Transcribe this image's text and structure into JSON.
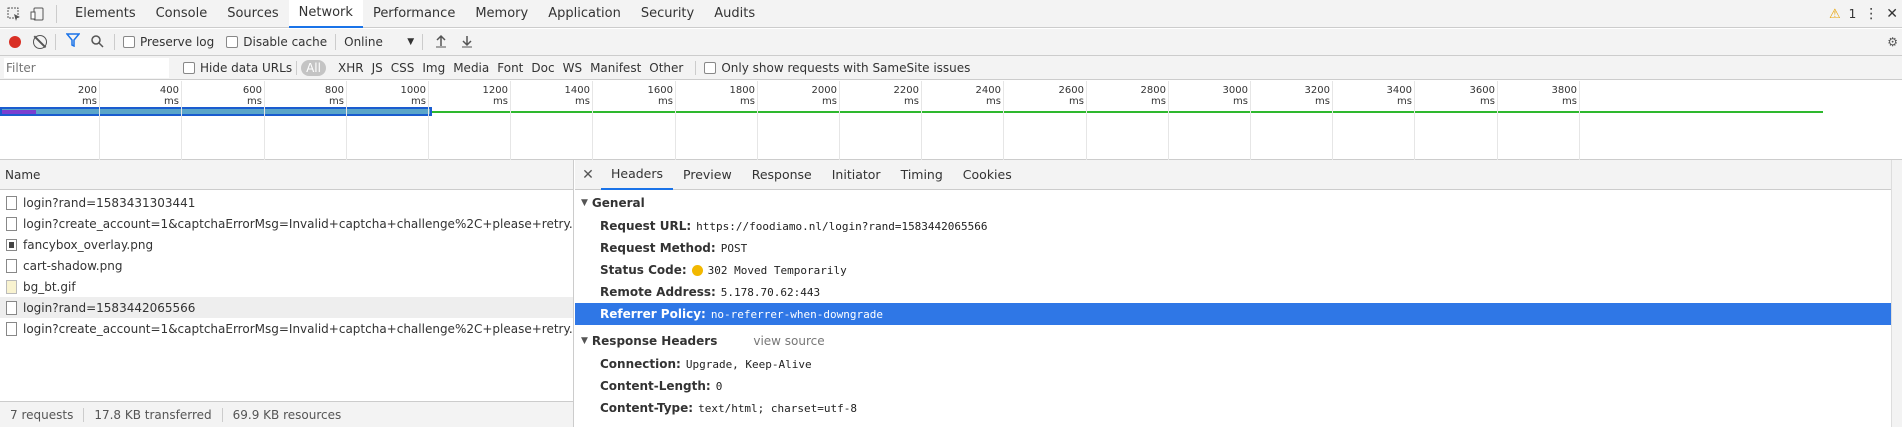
{
  "tabs": [
    "Elements",
    "Console",
    "Sources",
    "Network",
    "Performance",
    "Memory",
    "Application",
    "Security",
    "Audits"
  ],
  "active_tab": "Network",
  "warning_count": "1",
  "toolbar": {
    "preserve_log": "Preserve log",
    "disable_cache": "Disable cache",
    "throttle": "Online"
  },
  "filter": {
    "placeholder": "Filter",
    "hide_data_urls": "Hide data URLs",
    "types": [
      "All",
      "XHR",
      "JS",
      "CSS",
      "Img",
      "Media",
      "Font",
      "Doc",
      "WS",
      "Manifest",
      "Other"
    ],
    "samesite": "Only show requests with SameSite issues"
  },
  "timeline": {
    "ticks": [
      "200 ms",
      "400 ms",
      "600 ms",
      "800 ms",
      "1000 ms",
      "1200 ms",
      "1400 ms",
      "1600 ms",
      "1800 ms",
      "2000 ms",
      "2200 ms",
      "2400 ms",
      "2600 ms",
      "2800 ms",
      "3000 ms",
      "3200 ms",
      "3400 ms",
      "3600 ms",
      "3800 ms"
    ]
  },
  "requests_panel": {
    "header": "Name",
    "items": [
      {
        "name": "login?rand=1583431303441",
        "type": "doc"
      },
      {
        "name": "login?create_account=1&captchaErrorMsg=Invalid+captcha+challenge%2C+please+retry.",
        "type": "doc"
      },
      {
        "name": "fancybox_overlay.png",
        "type": "img"
      },
      {
        "name": "cart-shadow.png",
        "type": "doc"
      },
      {
        "name": "bg_bt.gif",
        "type": "gif"
      },
      {
        "name": "login?rand=1583442065566",
        "type": "doc"
      },
      {
        "name": "login?create_account=1&captchaErrorMsg=Invalid+captcha+challenge%2C+please+retry.",
        "type": "doc"
      }
    ],
    "selected_index": 5,
    "status": {
      "requests": "7 requests",
      "transferred": "17.8 KB transferred",
      "resources": "69.9 KB resources"
    }
  },
  "details": {
    "tabs": [
      "Headers",
      "Preview",
      "Response",
      "Initiator",
      "Timing",
      "Cookies"
    ],
    "active": "Headers",
    "general_title": "General",
    "general": [
      {
        "key": "Request URL:",
        "value": "https://foodiamo.nl/login?rand=1583442065566"
      },
      {
        "key": "Request Method:",
        "value": "POST"
      },
      {
        "key": "Status Code:",
        "value": "302 Moved Temporarily"
      },
      {
        "key": "Remote Address:",
        "value": "5.178.70.62:443"
      },
      {
        "key": "Referrer Policy:",
        "value": "no-referrer-when-downgrade"
      }
    ],
    "response_title": "Response Headers",
    "view_source": "view source",
    "response": [
      {
        "key": "Connection:",
        "value": "Upgrade, Keep-Alive"
      },
      {
        "key": "Content-Length:",
        "value": "0"
      },
      {
        "key": "Content-Type:",
        "value": "text/html; charset=utf-8"
      }
    ]
  }
}
